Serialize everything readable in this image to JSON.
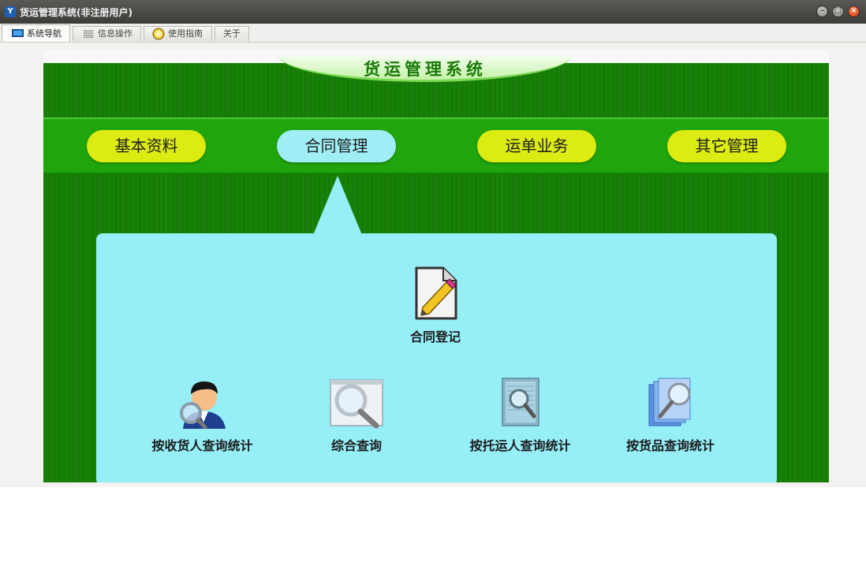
{
  "window": {
    "title": "货运管理系统(非注册用户)",
    "icon_letter": "Y",
    "controls": [
      "minimize-icon",
      "maximize-icon",
      "close-icon"
    ]
  },
  "tabs": [
    {
      "label": "系统导航",
      "icon": "monitor-icon",
      "active": true
    },
    {
      "label": "信息操作",
      "icon": "grid-icon",
      "active": false
    },
    {
      "label": "使用指南",
      "icon": "help-face-icon",
      "active": false
    },
    {
      "label": "关于",
      "icon": "",
      "active": false
    }
  ],
  "banner": {
    "title": "货运管理系统"
  },
  "nav": {
    "items": [
      {
        "label": "基本资料",
        "active": false
      },
      {
        "label": "合同管理",
        "active": true
      },
      {
        "label": "运单业务",
        "active": false
      },
      {
        "label": "其它管理",
        "active": false
      }
    ]
  },
  "panel": {
    "primary": {
      "label": "合同登记",
      "icon": "edit-document-icon"
    },
    "items": [
      {
        "label": "按收货人查询统计",
        "icon": "user-search-icon"
      },
      {
        "label": "综合查询",
        "icon": "magnifier-window-icon"
      },
      {
        "label": "按托运人查询统计",
        "icon": "document-search-icon"
      },
      {
        "label": "按货品查询统计",
        "icon": "stack-search-icon"
      }
    ]
  },
  "colors": {
    "board_green": "#177c07",
    "nav_band": "#21a50c",
    "pill_yellow": "#dceb12",
    "pill_active": "#a0eef5",
    "panel_cyan": "#96eef7",
    "titlebar": "#3d3c39"
  }
}
